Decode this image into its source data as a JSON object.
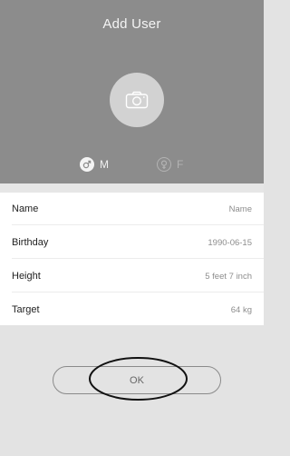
{
  "header": {
    "title": "Add User",
    "avatar_icon": "camera-icon",
    "gender": [
      {
        "icon": "male-icon",
        "label": "M",
        "selected": true
      },
      {
        "icon": "female-icon",
        "label": "F",
        "selected": false
      }
    ]
  },
  "form": {
    "rows": [
      {
        "label": "Name",
        "value": "Name"
      },
      {
        "label": "Birthday",
        "value": "1990-06-15"
      },
      {
        "label": "Height",
        "value": "5 feet 7 inch"
      },
      {
        "label": "Target",
        "value": "64 kg"
      }
    ]
  },
  "footer": {
    "ok_label": "OK"
  },
  "colors": {
    "header_bg": "#8c8c8c",
    "form_bg": "#ffffff",
    "footer_bg": "#e3e3e3"
  }
}
